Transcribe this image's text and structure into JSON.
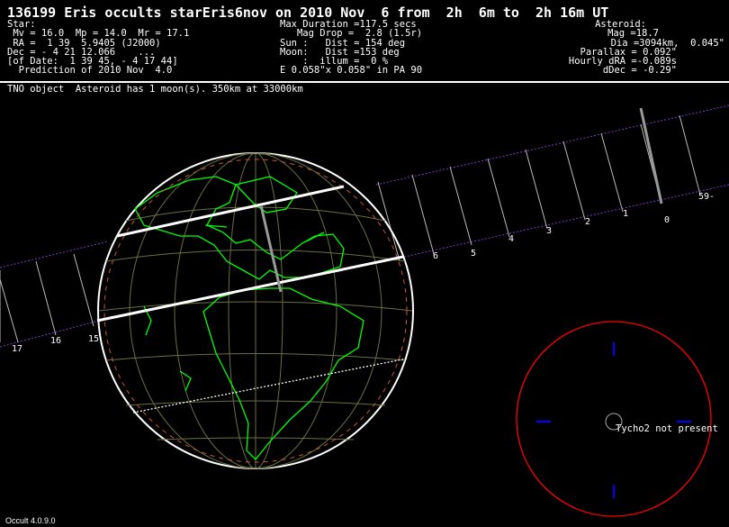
{
  "header": {
    "title": "136199 Eris occults starEris6nov on 2010 Nov  6 from  2h  6m to  2h 16m UT"
  },
  "star_block": [
    "Star:",
    " Mv = 16.0  Mp = 14.0  Mr = 17.1",
    " RA =  1 39  5.9405 (J2000)",
    "Dec = - 4 21 12.066    ...",
    "[of Date:  1 39 45, - 4 17 44]",
    "  Prediction of 2010 Nov  4.0"
  ],
  "event_block": [
    "Max Duration =117.5 secs",
    "   Mag Drop =  2.8 (1.5r)",
    "Sun :   Dist = 154 deg",
    "Moon:   Dist =153 deg",
    "    :  illum =  0 %",
    "E 0.058\"x 0.058\" in PA 90"
  ],
  "asteroid_block": [
    "Asteroid:",
    "Mag =18.7",
    "Dia =3094km,  0.045\"",
    "Parallax = 0.092\"",
    "Hourly dRA =-0.089s",
    "dDec = -0.29\""
  ],
  "info_line": "TNO object  Asteroid has 1 moon(s). 350km at 33000km",
  "path_ticks": [
    "59-",
    "0",
    "1",
    "2",
    "3",
    "4",
    "5",
    "6",
    "15",
    "16",
    "17"
  ],
  "star_field_note": "Tycho2 not present",
  "version": "Occult 4.0.9.0",
  "colors": {
    "background": "#000000",
    "coastline": "#00ff00",
    "grid": "#6a7040",
    "path": "#ffffff",
    "track": "#7a3dcc",
    "star_field_circle": "#ff0000",
    "star_field_ticks": "#0000ff"
  }
}
